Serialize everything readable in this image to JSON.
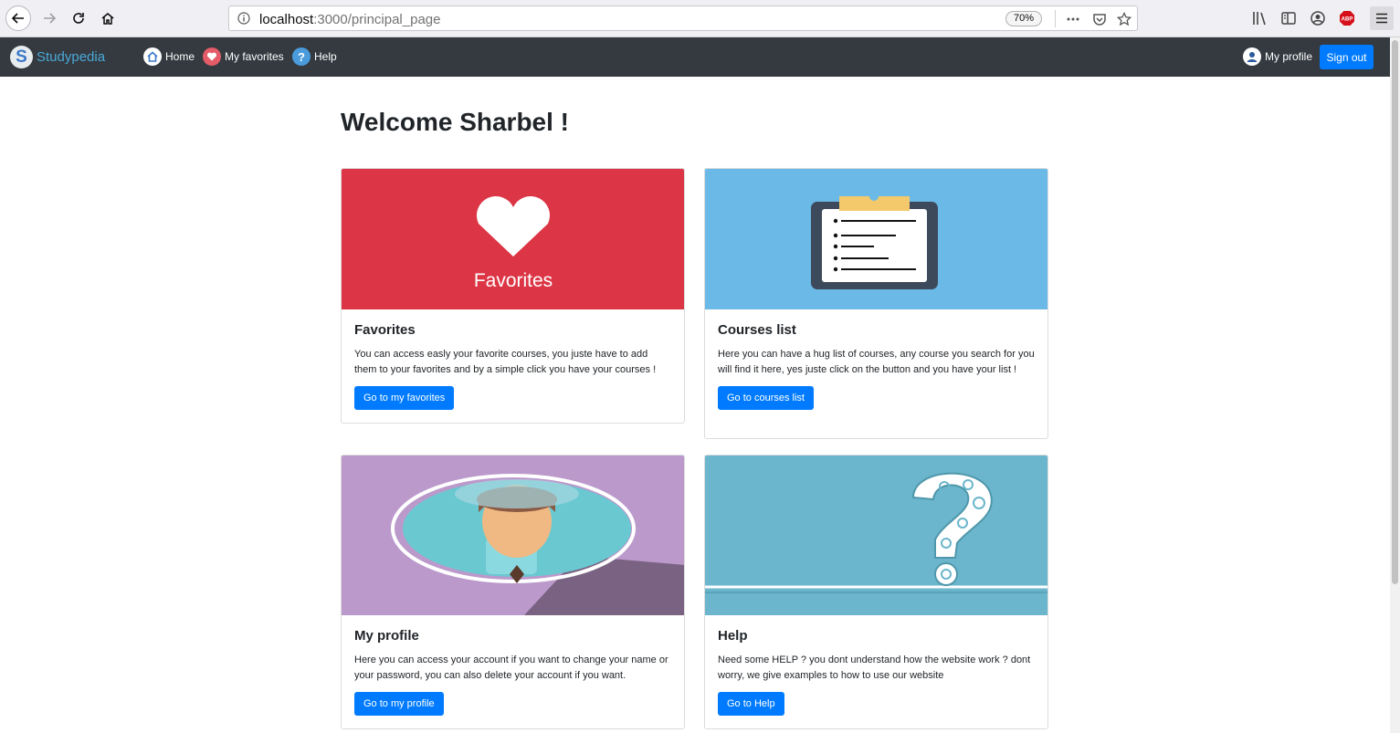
{
  "browser": {
    "url_host": "localhost",
    "url_path": ":3000/principal_page",
    "zoom": "70%"
  },
  "navbar": {
    "brand": "Studypedia",
    "brand_letter": "S",
    "links": {
      "home": "Home",
      "favorites": "My favorites",
      "help": "Help",
      "profile": "My profile"
    },
    "signout": "Sign out"
  },
  "main": {
    "welcome": "Welcome Sharbel !",
    "cards": {
      "favorites": {
        "image_text": "Favorites",
        "title": "Favorites",
        "text": "You can access easly your favorite courses, you juste have to add them to your favorites and by a simple click you have your courses !",
        "button": "Go to my favorites"
      },
      "courses": {
        "title": "Courses list",
        "text": "Here you can have a hug list of courses, any course you search for you will find it here, yes juste click on the button and you have your list !",
        "button": "Go to courses list"
      },
      "profile": {
        "title": "My profile",
        "text": "Here you can access your account if you want to change your name or your password, you can also delete your account if you want.",
        "button": "Go to my profile"
      },
      "help": {
        "title": "Help",
        "text": "Need some HELP ? you dont understand how the website work ? dont worry, we give examples to how to use our website",
        "button": "Go to Help"
      }
    }
  },
  "colors": {
    "primary": "#007bff",
    "navbar": "#343a40",
    "favorites_bg": "#dc3545",
    "courses_bg": "#6ab9e6",
    "profile_bg": "#bb99cb",
    "help_bg": "#6bb6cc"
  }
}
